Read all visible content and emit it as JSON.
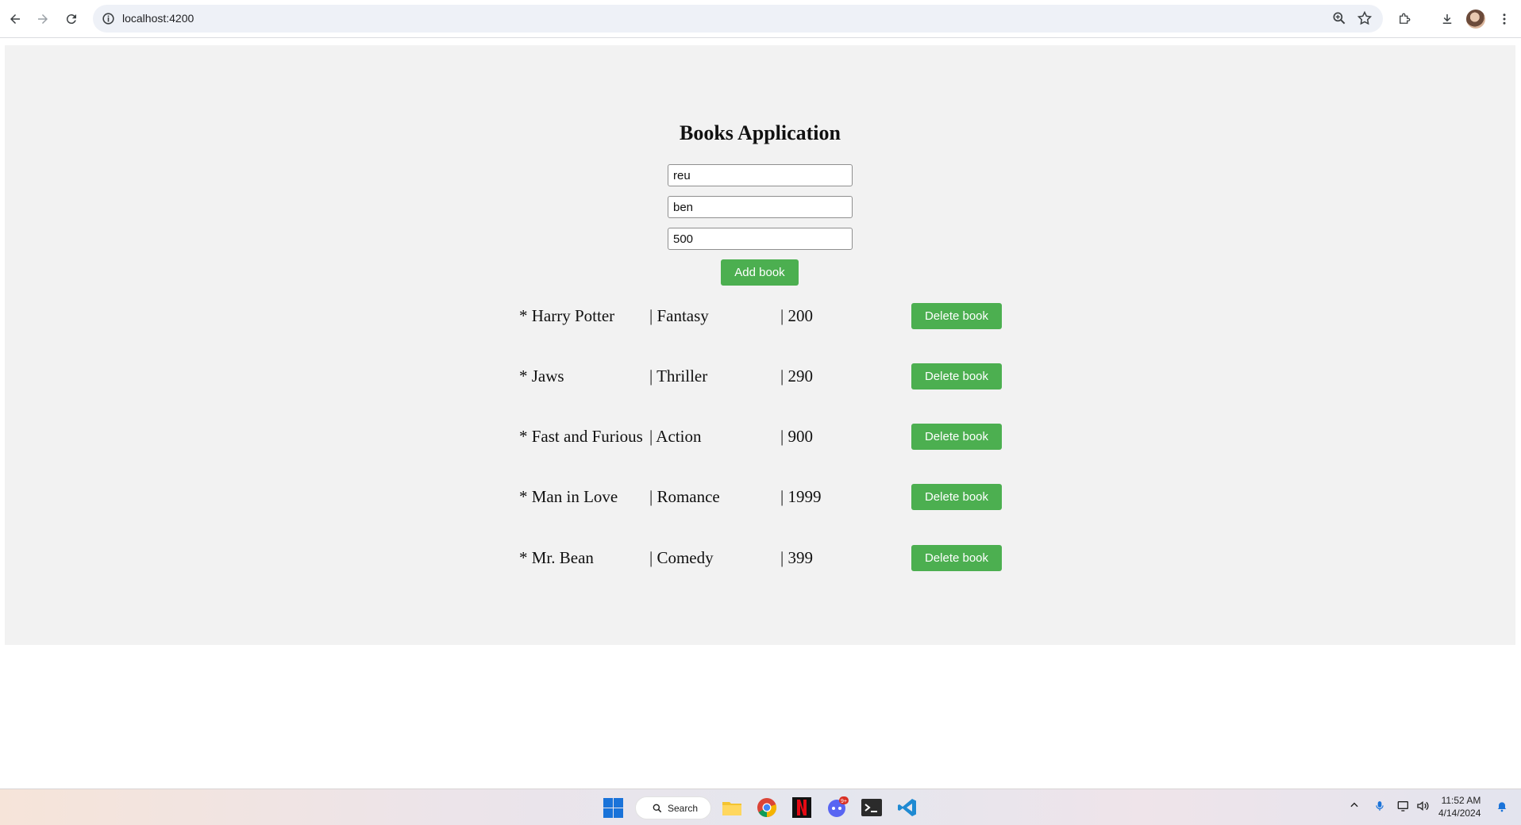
{
  "browser": {
    "url": "localhost:4200"
  },
  "app": {
    "title": "Books Application",
    "inputs": {
      "name_value": "reu",
      "genre_value": "ben",
      "price_value": "500"
    },
    "add_button_label": "Add book",
    "delete_button_label": "Delete book",
    "books": [
      {
        "name": "* Harry Potter",
        "genre": "| Fantasy",
        "price": "| 200"
      },
      {
        "name": "* Jaws",
        "genre": "| Thriller",
        "price": "| 290"
      },
      {
        "name": "* Fast and Furious",
        "genre": "| Action",
        "price": "| 900"
      },
      {
        "name": "* Man in Love",
        "genre": "| Romance",
        "price": "| 1999"
      },
      {
        "name": "* Mr. Bean",
        "genre": "| Comedy",
        "price": "| 399"
      }
    ]
  },
  "taskbar": {
    "search_label": "Search",
    "time": "11:52 AM",
    "date": "4/14/2024",
    "chat_badge": "9+"
  },
  "colors": {
    "button_green": "#4caf50",
    "page_bg": "#f2f2f2",
    "windows_blue": "#1a73d9"
  }
}
